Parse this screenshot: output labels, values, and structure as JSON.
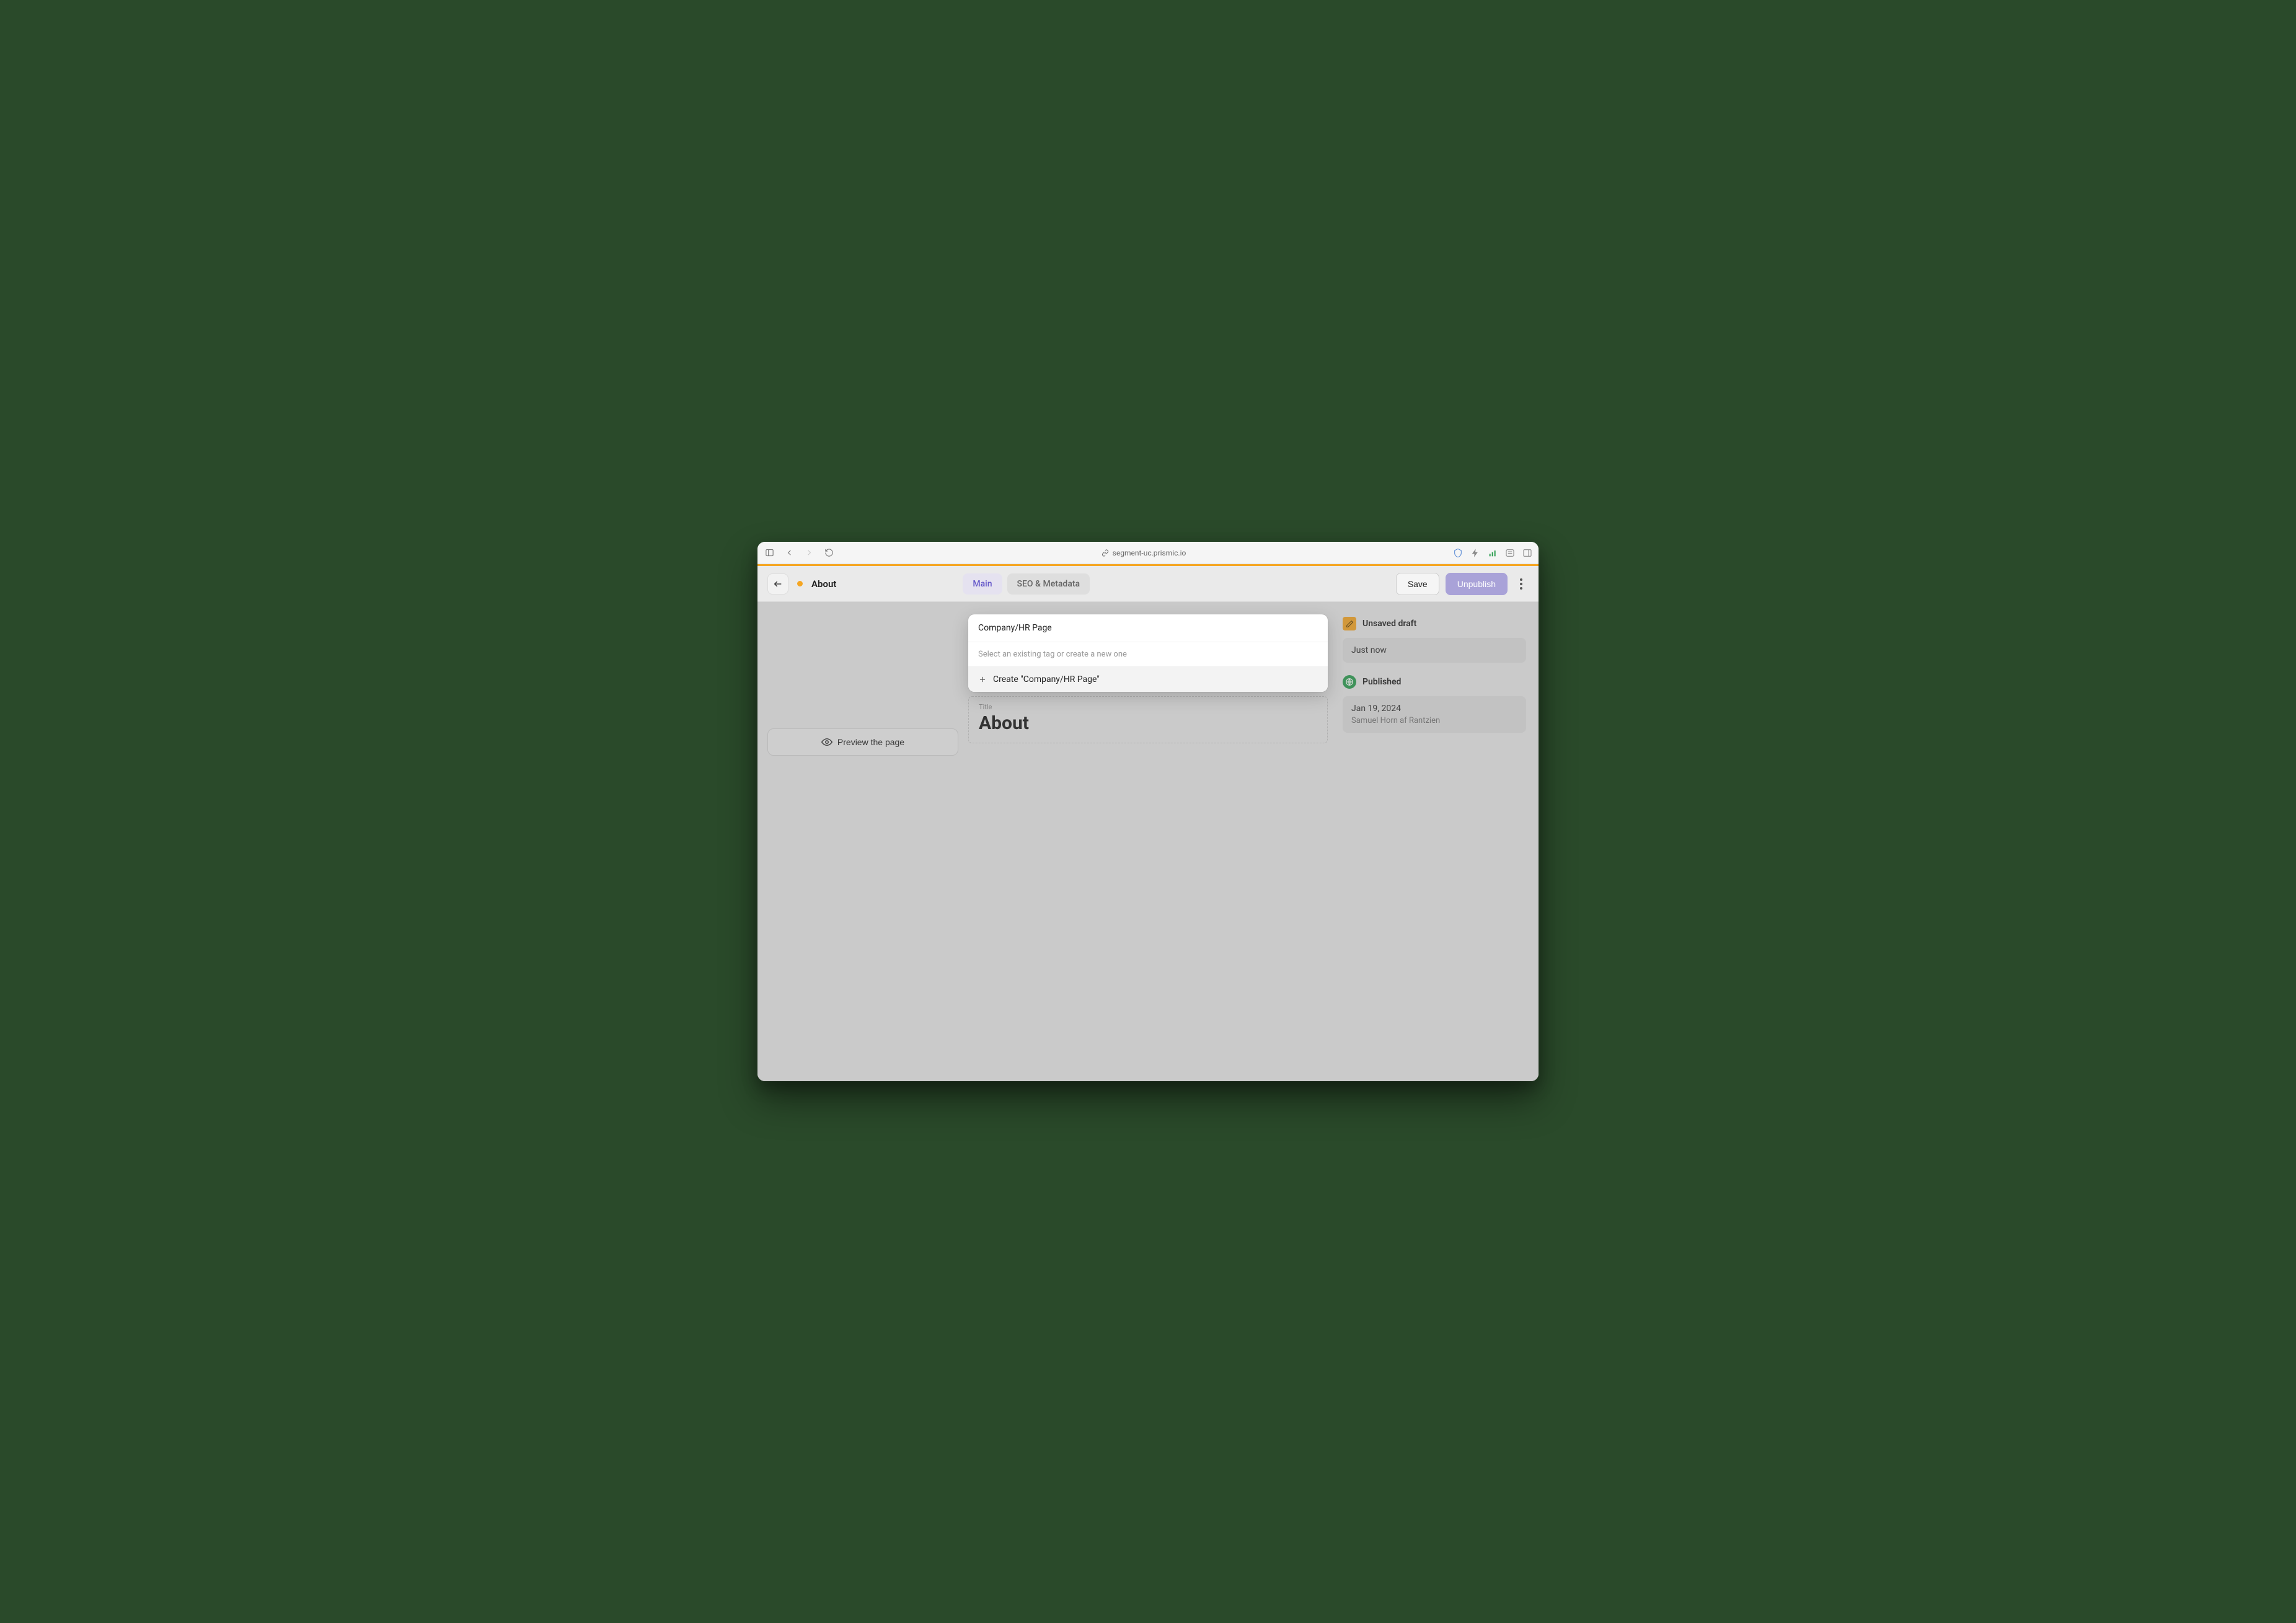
{
  "browser": {
    "url": "segment-uc.prismic.io"
  },
  "header": {
    "page_title": "About",
    "tabs": [
      {
        "label": "Main",
        "active": true
      },
      {
        "label": "SEO & Metadata",
        "active": false
      }
    ],
    "save_label": "Save",
    "unpublish_label": "Unpublish"
  },
  "preview_button": "Preview the page",
  "title_field": {
    "label": "Title",
    "value": "About"
  },
  "tag_popup": {
    "input_value": "Company/HR Page",
    "hint": "Select an existing tag or create a new one",
    "create_label": "Create \"Company/HR Page\""
  },
  "sidebar": {
    "draft_label": "Unsaved draft",
    "draft_time": "Just now",
    "published_label": "Published",
    "published_date": "Jan 19, 2024",
    "published_author": "Samuel Horn af Rantzien"
  }
}
